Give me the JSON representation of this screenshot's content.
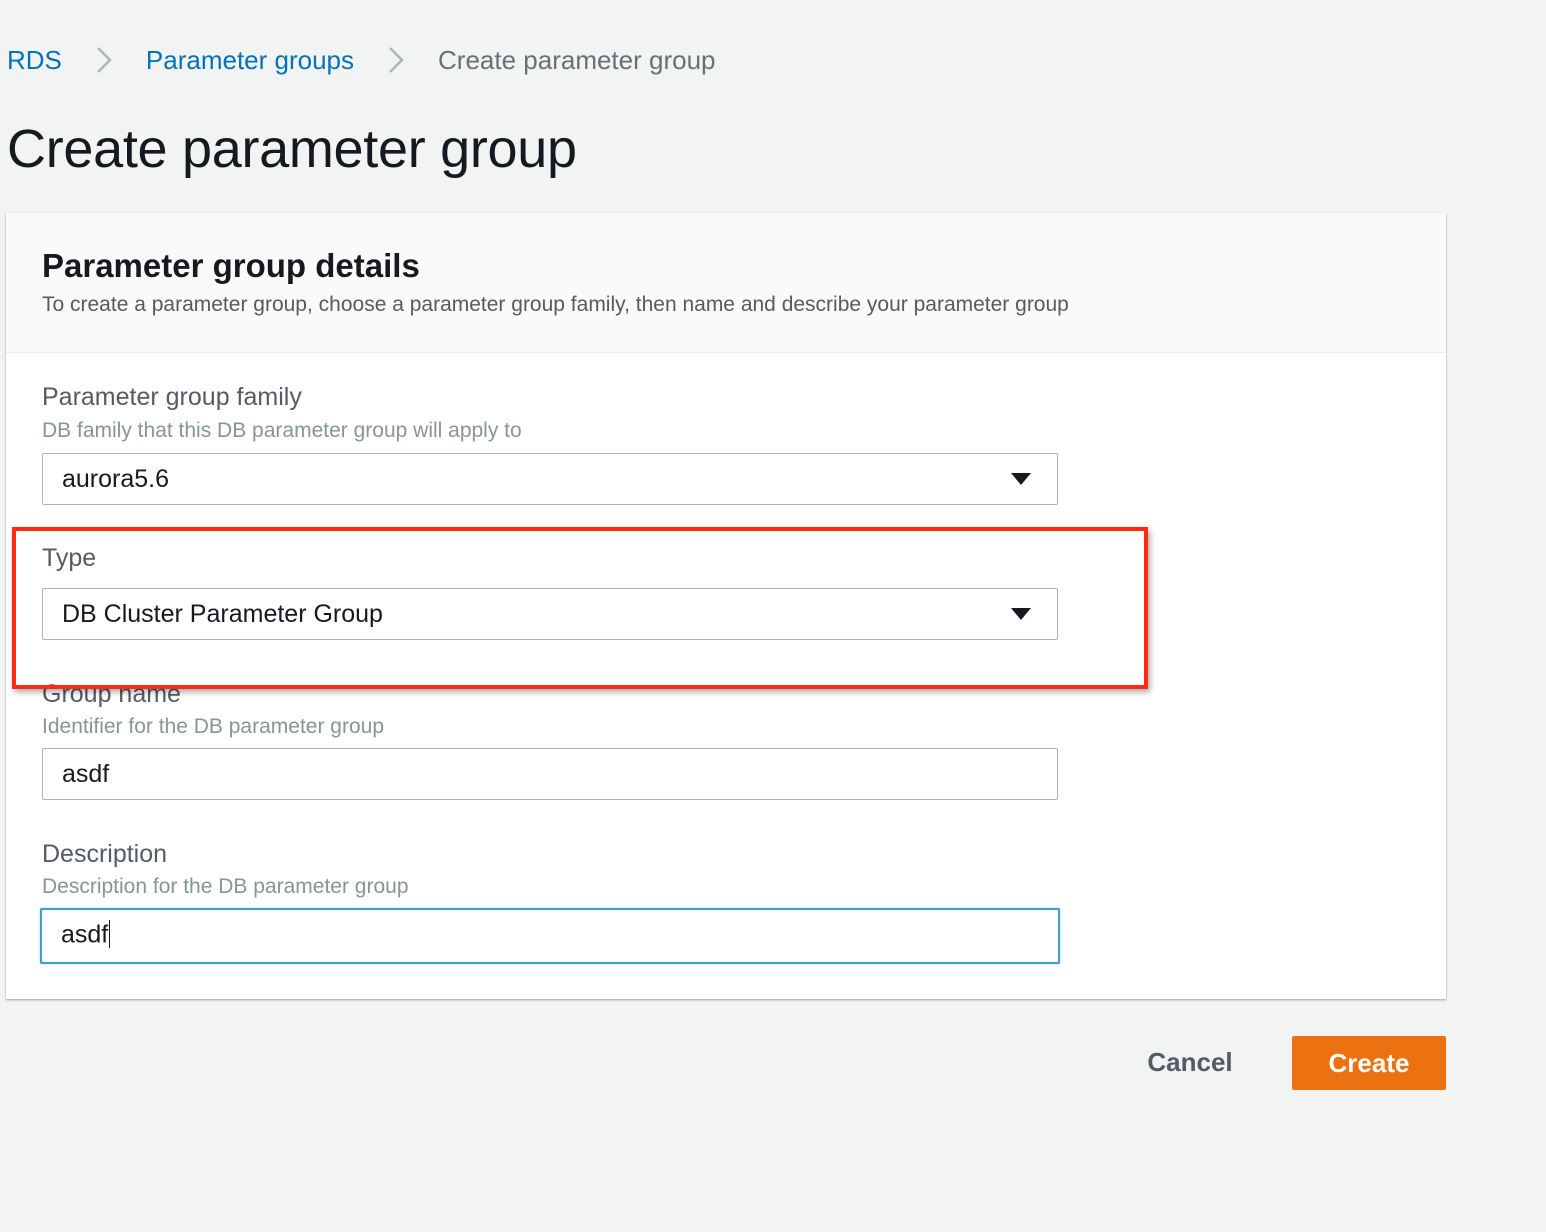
{
  "breadcrumb": {
    "items": [
      {
        "label": "RDS"
      },
      {
        "label": "Parameter groups"
      },
      {
        "label": "Create parameter group"
      }
    ]
  },
  "page_title": "Create parameter group",
  "panel": {
    "title": "Parameter group details",
    "description": "To create a parameter group, choose a parameter group family, then name and describe your parameter group"
  },
  "fields": {
    "family": {
      "label": "Parameter group family",
      "hint": "DB family that this DB parameter group will apply to",
      "value": "aurora5.6"
    },
    "type": {
      "label": "Type",
      "value": "DB Cluster Parameter Group"
    },
    "group_name": {
      "label": "Group name",
      "hint": "Identifier for the DB parameter group",
      "value": "asdf"
    },
    "description": {
      "label": "Description",
      "hint": "Description for the DB parameter group",
      "value": "asdf"
    }
  },
  "actions": {
    "cancel_label": "Cancel",
    "create_label": "Create"
  },
  "colors": {
    "link": "#0073bb",
    "primary_button": "#ec7211",
    "highlight": "#ff2a12",
    "focus_border": "#3f9fc7"
  },
  "icons": {
    "separator": "chevron-right-icon",
    "select_caret": "caret-down-icon"
  }
}
